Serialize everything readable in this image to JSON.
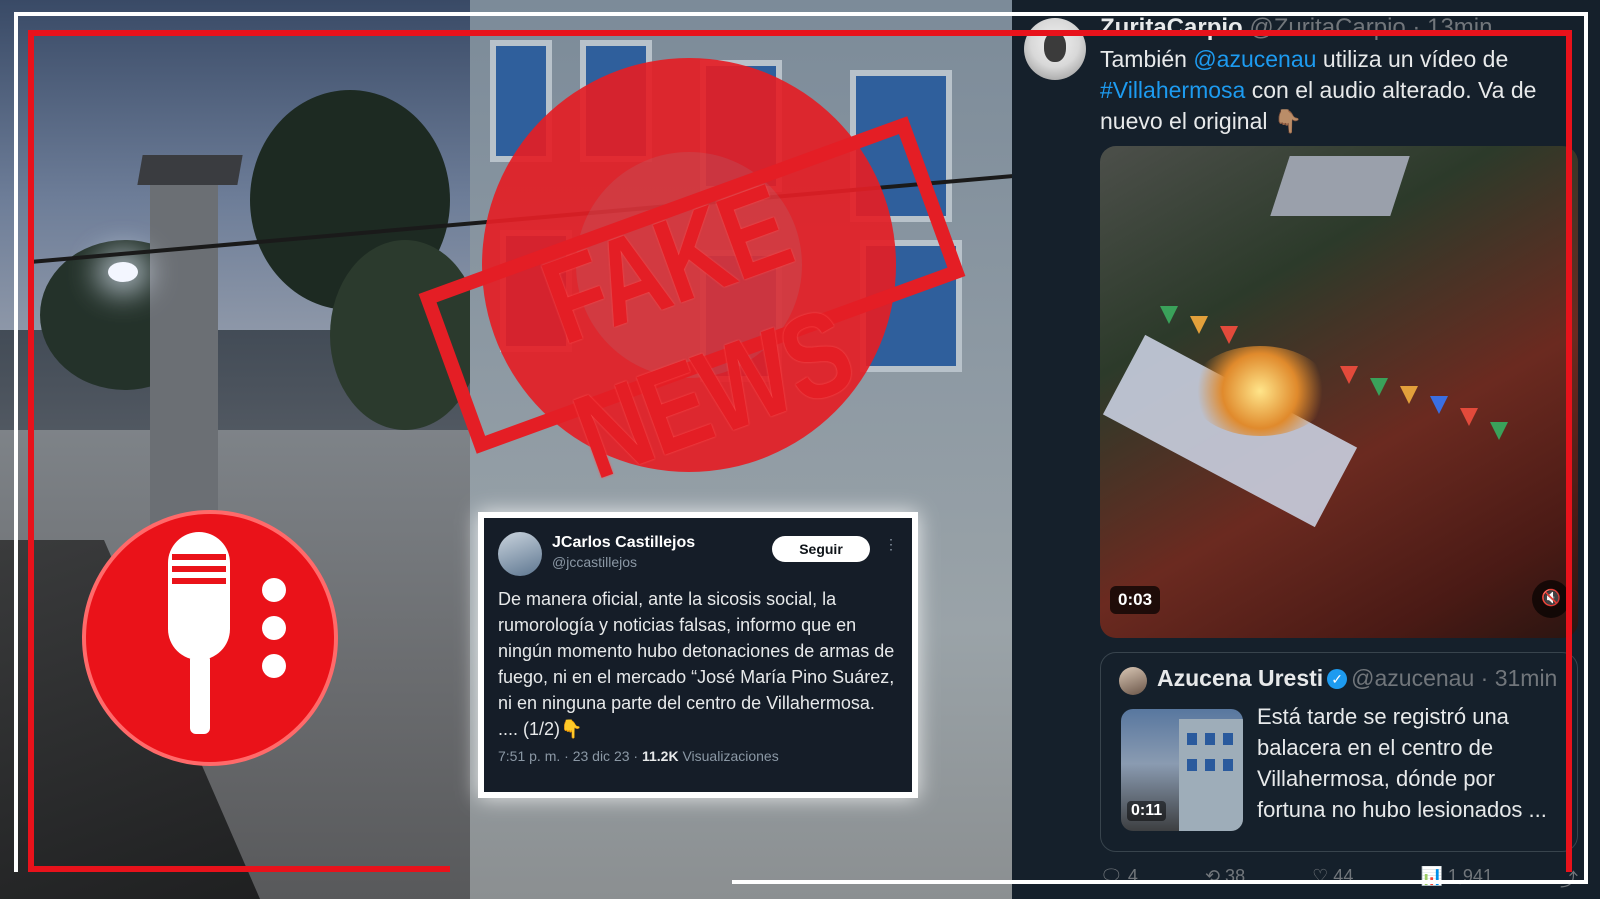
{
  "stamp": {
    "text": "FAKE NEWS",
    "color": "#e41e25"
  },
  "frame": {
    "accent": "#e8121b"
  },
  "embedded_tweet": {
    "name": "JCarlos Castillejos",
    "handle": "@jccastillejos",
    "follow_label": "Seguir",
    "more_icon": "⋮",
    "text": "De manera oficial, ante la sicosis social, la rumorología y noticias falsas, informo que en ningún momento hubo detonaciones de armas de fuego, ni en el mercado “José María Pino Suárez,  ni en ninguna parte del centro de Villahermosa.  .... (1/2)👇",
    "time": "7:51 p. m. · 23 dic 23 · ",
    "views_count": "11.2K",
    "views_label": " Visualizaciones"
  },
  "right_tweet": {
    "name": "ZuritaCarpio",
    "handle_time": " @ZuritaCarpio · 13min",
    "text_prefix": "También ",
    "mention": "@azucenau",
    "text_mid": " utiliza un vídeo de ",
    "hashtag": "#Villahermosa",
    "text_suffix": " con el audio alterado. Va de nuevo el original 👇🏽",
    "video_time": "0:03",
    "mute_icon": "🔇",
    "quote": {
      "name": "Azucena Uresti",
      "verified_icon": "✓",
      "handle_time": "@azucenau · 31min",
      "text": "Está tarde se registró una balacera en el centro de Villahermosa, dónde por fortuna no hubo lesionados ...",
      "thumb_time": "0:11"
    },
    "actions": {
      "reply": "🗨 4",
      "retweet": "⟲ 38",
      "like": "♡ 44",
      "views": "📊 1,941",
      "share": "⤴"
    }
  }
}
